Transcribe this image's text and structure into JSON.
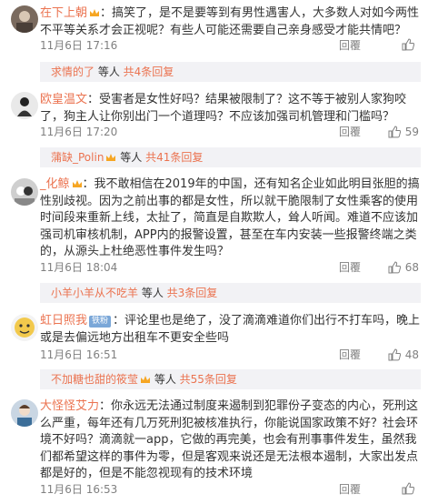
{
  "comments": [
    {
      "nick": "在下上朝",
      "text": "：搞笑了，是不是要等到有男性遇害人，大多数人对如今两性不平等关系才会正视呢？有些人可能还需要自己亲身感受才能共情吧？",
      "time": "11月6日 17:16",
      "reply": "回覆",
      "likes": "",
      "reply_thread": {
        "nick": "求情的了",
        "middle": " 等人 ",
        "link": "共4条回复"
      }
    },
    {
      "nick": "欧皇温文",
      "text": "：受害者是女性好吗？结果被限制了？这不等于被别人家狗咬了，狗主人让你别出门一个道理吗？不应该加强司机管理和门槛吗？",
      "time": "11月6日 17:20",
      "reply": "回覆",
      "likes": "59",
      "reply_thread": {
        "nick": "蒲缺_Polin",
        "middle": " 等人 ",
        "link": "共41条回复"
      }
    },
    {
      "nick": "_化鲸",
      "text": "：我不敢相信在2019年的中国，还有知名企业如此明目张胆的搞性别歧视。因为之前出事的都是女性，所以就干脆限制了女性乘客的使用时间段来重新上线，太扯了，简直是自欺欺人，耸人听闻。难道不应该加强司机审核机制，APP内的报警设置，甚至在车内安装一些报警终端之类的，从源头上杜绝恶性事件发生吗？",
      "time": "11月6日 18:04",
      "reply": "回覆",
      "likes": "68",
      "reply_thread": {
        "nick": "小羊小羊从不吃羊",
        "middle": " 等人 ",
        "link": "共3条回复"
      }
    },
    {
      "nick": "虹日照我",
      "badge": "铁粉",
      "text": "：评论里也是绝了，没了滴滴难道你们出行不打车吗，晚上或是去偏远地方出租车不更安全些吗",
      "time": "11月6日 16:51",
      "reply": "回覆",
      "likes": "48",
      "reply_thread": {
        "nick": "不加糖也甜的筱莹",
        "middle": " 等人 ",
        "link": "共55条回复"
      }
    },
    {
      "nick": "大怪怪艾力",
      "text": "：你永远无法通过制度来遏制到犯罪份子变态的内心，死刑这么严重，每年还有几万死刑犯被核准执行，你能说国家政策不好？社会环境不好吗？滴滴就一app，它做的再完美，也会有刑事事件发生，虽然我们都希望这样的事件为零，但是客观来说还是无法根本遏制，大家出发点都是好的，但是不能忽视现有的技术环境",
      "time": "11月6日 16:53",
      "reply": "回覆",
      "likes": "",
      "reply_thread": null
    }
  ],
  "colors": {
    "nick": "#eb7350",
    "text": "#333333",
    "meta": "#808080",
    "reply_bg": "#f2f2f5"
  },
  "icons": {
    "like": "thumbs-up-icon",
    "crown": "crown-icon",
    "vip": "vip-icon"
  }
}
